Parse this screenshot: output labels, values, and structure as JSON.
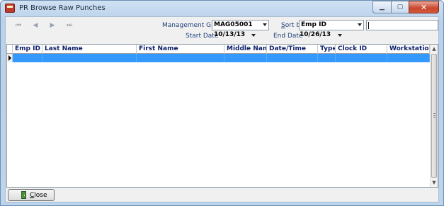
{
  "window": {
    "title": "PR Browse Raw Punches",
    "controls": {
      "minimize": "▁",
      "maximize": "▢",
      "close": "✕"
    }
  },
  "nav": {
    "first": "⏮",
    "prev": "◀",
    "next": "▶",
    "last": "⏭"
  },
  "filters": {
    "management_group_label": "Management Group",
    "management_group_value": "MAG05001",
    "sort_by_label": "Sort by",
    "sort_by_value": "Emp ID",
    "search_value": "",
    "start_date_label": "Start Date",
    "start_date_value": "10/13/13",
    "end_date_label": "End Date",
    "end_date_value": "10/26/13"
  },
  "grid": {
    "columns": [
      "Emp ID",
      "Last Name",
      "First Name",
      "Middle Name",
      "Date/Time",
      "Type",
      "Clock ID",
      "Workstation"
    ],
    "selected_row_color": "#3399ff"
  },
  "footer": {
    "close_label": "Close"
  }
}
